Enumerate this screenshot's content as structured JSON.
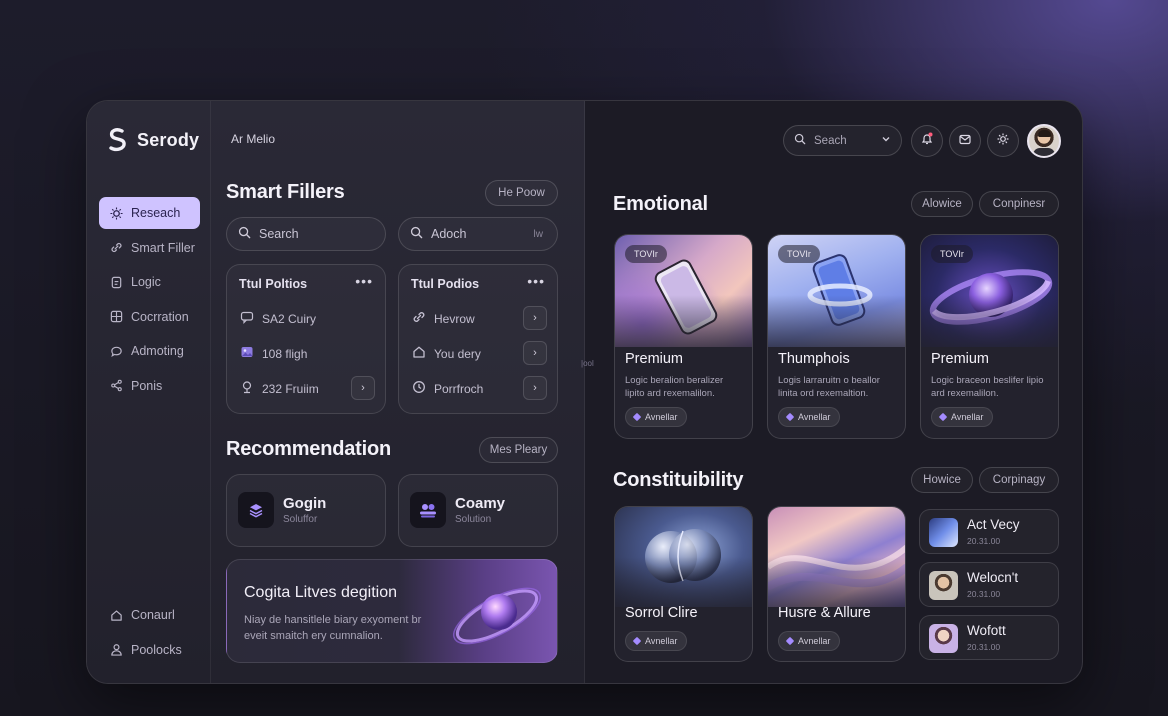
{
  "brand": {
    "name": "Serody"
  },
  "topmenu": {
    "label": "Ar Melio"
  },
  "sidebar": {
    "items": [
      {
        "label": "Reseach",
        "icon": "settings-gear-icon",
        "active": true
      },
      {
        "label": "Smart Filler",
        "icon": "link-icon"
      },
      {
        "label": "Logic",
        "icon": "document-icon"
      },
      {
        "label": "Cocrration",
        "icon": "grid-icon"
      },
      {
        "label": "Admoting",
        "icon": "chat-bubble-icon"
      },
      {
        "label": "Ponis",
        "icon": "share-icon"
      }
    ],
    "bottom_items": [
      {
        "label": "Conaurl",
        "icon": "home-icon"
      },
      {
        "label": "Poolocks",
        "icon": "user-icon"
      }
    ]
  },
  "smart_fillers": {
    "title": "Smart Fillers",
    "action_label": "He Poow",
    "search_placeholder": "Search",
    "adoch_placeholder": "Adoch",
    "adoch_trail": "lw",
    "card1": {
      "title": "Ttul Poltios",
      "rows": [
        {
          "icon": "message-icon",
          "label": "SA2 Cuiry"
        },
        {
          "icon": "image-icon",
          "label": "108 fligh"
        },
        {
          "icon": "location-pin-icon",
          "label": "232 Fruiim"
        }
      ]
    },
    "card2": {
      "title": "Ttul Podios",
      "rows": [
        {
          "icon": "link-icon",
          "label": "Hevrow"
        },
        {
          "icon": "home-icon",
          "label": "You dery"
        },
        {
          "icon": "clock-icon",
          "label": "Porrfroch"
        }
      ]
    }
  },
  "recommendation": {
    "title": "Recommendation",
    "action_label": "Mes Pleary",
    "cards": [
      {
        "title": "Gogin",
        "subtitle": "Soluffor"
      },
      {
        "title": "Coamy",
        "subtitle": "Solution"
      }
    ],
    "banner": {
      "title": "Cogita Litves degition",
      "text": "Niay de hansitlele biary exyoment br eveit smaitch ery cumnalion."
    }
  },
  "divider_label": "|ool",
  "header": {
    "search_placeholder": "Seach",
    "icons": [
      "bell-icon",
      "mail-icon",
      "settings-icon"
    ]
  },
  "emotional": {
    "title": "Emotional",
    "filters": [
      "Alowice",
      "Conpinesr"
    ],
    "cards": [
      {
        "tag": "TOVIr",
        "title": "Premium",
        "text": "Logic beralion beralizer lipito ard rexemalilon.",
        "chip": "Avnellar"
      },
      {
        "tag": "TOVIr",
        "title": "Thumphois",
        "text": "Logis larraruitn o beallor linita ord rexemaltion.",
        "chip": "Avnellar"
      },
      {
        "tag": "TOVIr",
        "title": "Premium",
        "text": "Logic braceon beslifer lipio ard rexemalilon.",
        "chip": "Avnellar"
      }
    ]
  },
  "constitubility": {
    "title": "Constituibility",
    "filters": [
      "Howice",
      "Corpinagy"
    ],
    "cards": [
      {
        "title": "Sorrol Clire",
        "chip": "Avnellar"
      },
      {
        "title": "Husre & Allure",
        "chip": "Avnellar"
      }
    ],
    "list": [
      {
        "title": "Act Vecy",
        "time": "20.31.00"
      },
      {
        "title": "Welocn't",
        "time": "20.31.00"
      },
      {
        "title": "Wofott",
        "time": "20.31.00"
      }
    ]
  },
  "colors": {
    "accent": "#cfc3ff",
    "panel": "#1c1b25",
    "chip_dot": "#a48bff"
  }
}
